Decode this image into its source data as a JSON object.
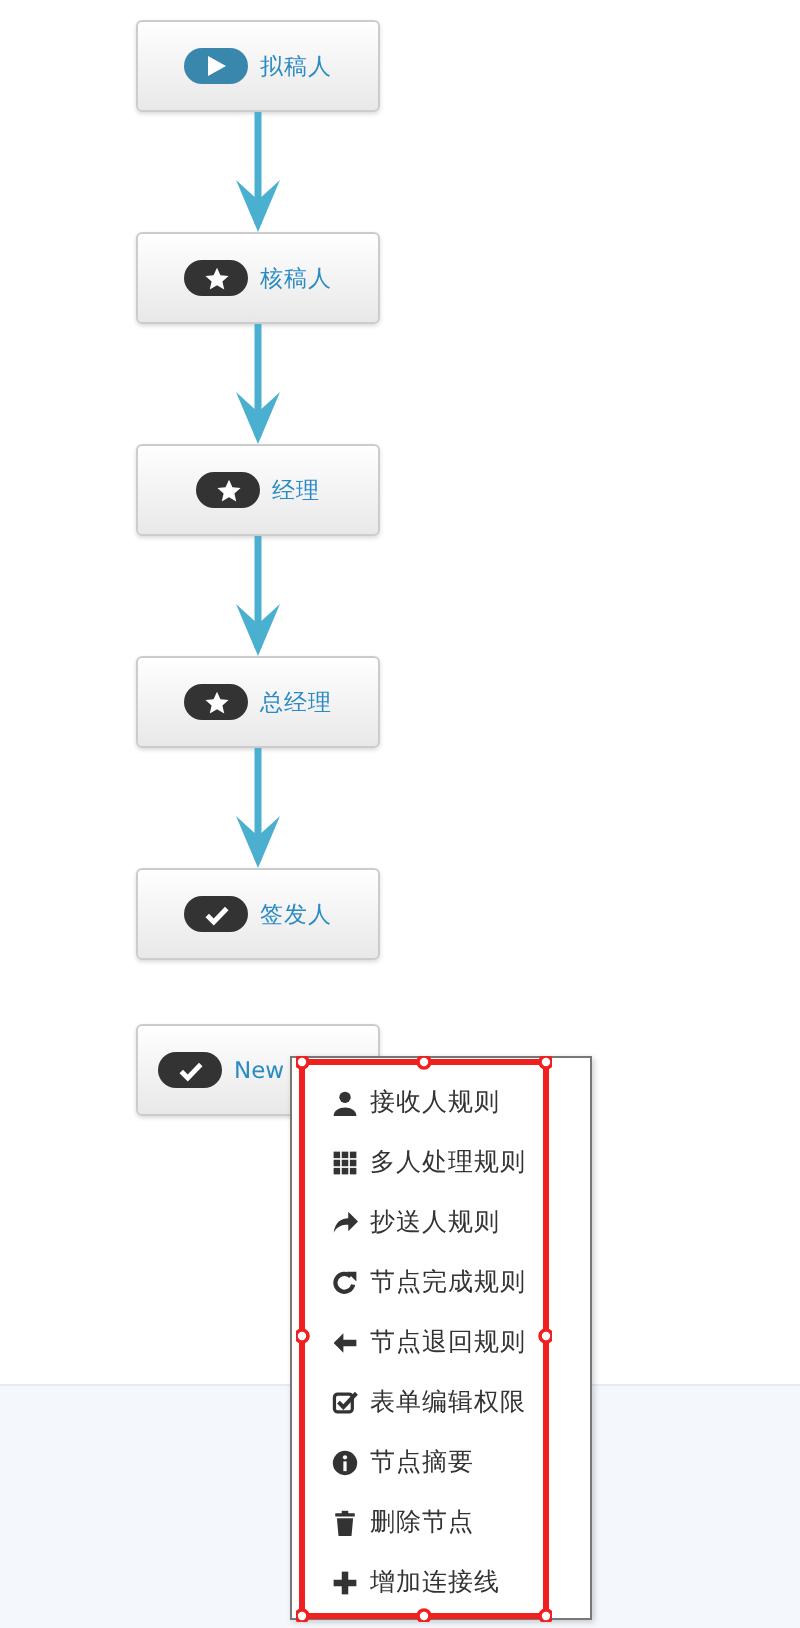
{
  "nodes": [
    {
      "label": "拟稿人",
      "kind": "start",
      "arrow_after": true
    },
    {
      "label": "核稿人",
      "kind": "star",
      "arrow_after": true
    },
    {
      "label": "经理",
      "kind": "star",
      "arrow_after": true
    },
    {
      "label": "总经理",
      "kind": "star",
      "arrow_after": true
    },
    {
      "label": "签发人",
      "kind": "check",
      "arrow_after": false
    },
    {
      "label": "New",
      "kind": "check",
      "arrow_after": false
    }
  ],
  "context_menu": {
    "items": [
      {
        "label": "接收人规则",
        "kind": "user"
      },
      {
        "label": "多人处理规则",
        "kind": "grid"
      },
      {
        "label": "抄送人规则",
        "kind": "share"
      },
      {
        "label": "节点完成规则",
        "kind": "refresh"
      },
      {
        "label": "节点退回规则",
        "kind": "left"
      },
      {
        "label": "表单编辑权限",
        "kind": "checkbox"
      },
      {
        "label": "节点摘要",
        "kind": "info"
      },
      {
        "label": "删除节点",
        "kind": "trash"
      },
      {
        "label": "增加连接线",
        "kind": "plus"
      }
    ]
  }
}
